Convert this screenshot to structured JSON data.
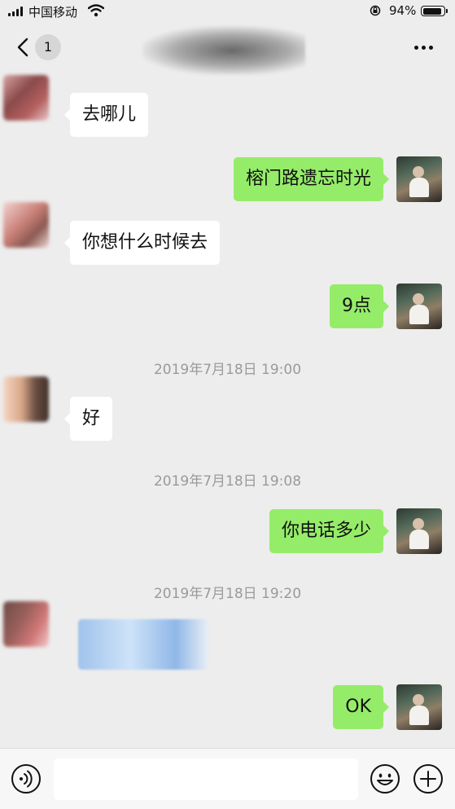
{
  "status_bar": {
    "carrier": "中国移动",
    "battery_percent": "94%",
    "battery_level": 0.94
  },
  "nav_bar": {
    "unread_count": "1",
    "title": ""
  },
  "messages": [
    {
      "side": "in",
      "text": "去哪儿"
    },
    {
      "side": "out",
      "text": "榕门路遗忘时光"
    },
    {
      "side": "in",
      "text": "你想什么时候去"
    },
    {
      "side": "out",
      "text": "9点"
    },
    {
      "side": "time",
      "text": "2019年7月18日 19:00"
    },
    {
      "side": "in",
      "text": "好"
    },
    {
      "side": "time",
      "text": "2019年7月18日 19:08"
    },
    {
      "side": "out",
      "text": "你电话多少"
    },
    {
      "side": "time",
      "text": "2019年7月18日 19:20"
    },
    {
      "side": "in",
      "text": "",
      "redacted": true
    },
    {
      "side": "out",
      "text": "OK"
    }
  ],
  "input_bar": {
    "icons": [
      "voice-icon",
      "emoji-icon",
      "plus-icon"
    ],
    "placeholder": ""
  },
  "colors": {
    "background": "#ededed",
    "outgoing_bubble": "#95ec69",
    "incoming_bubble": "#ffffff",
    "timestamp": "#9a9a9a"
  }
}
